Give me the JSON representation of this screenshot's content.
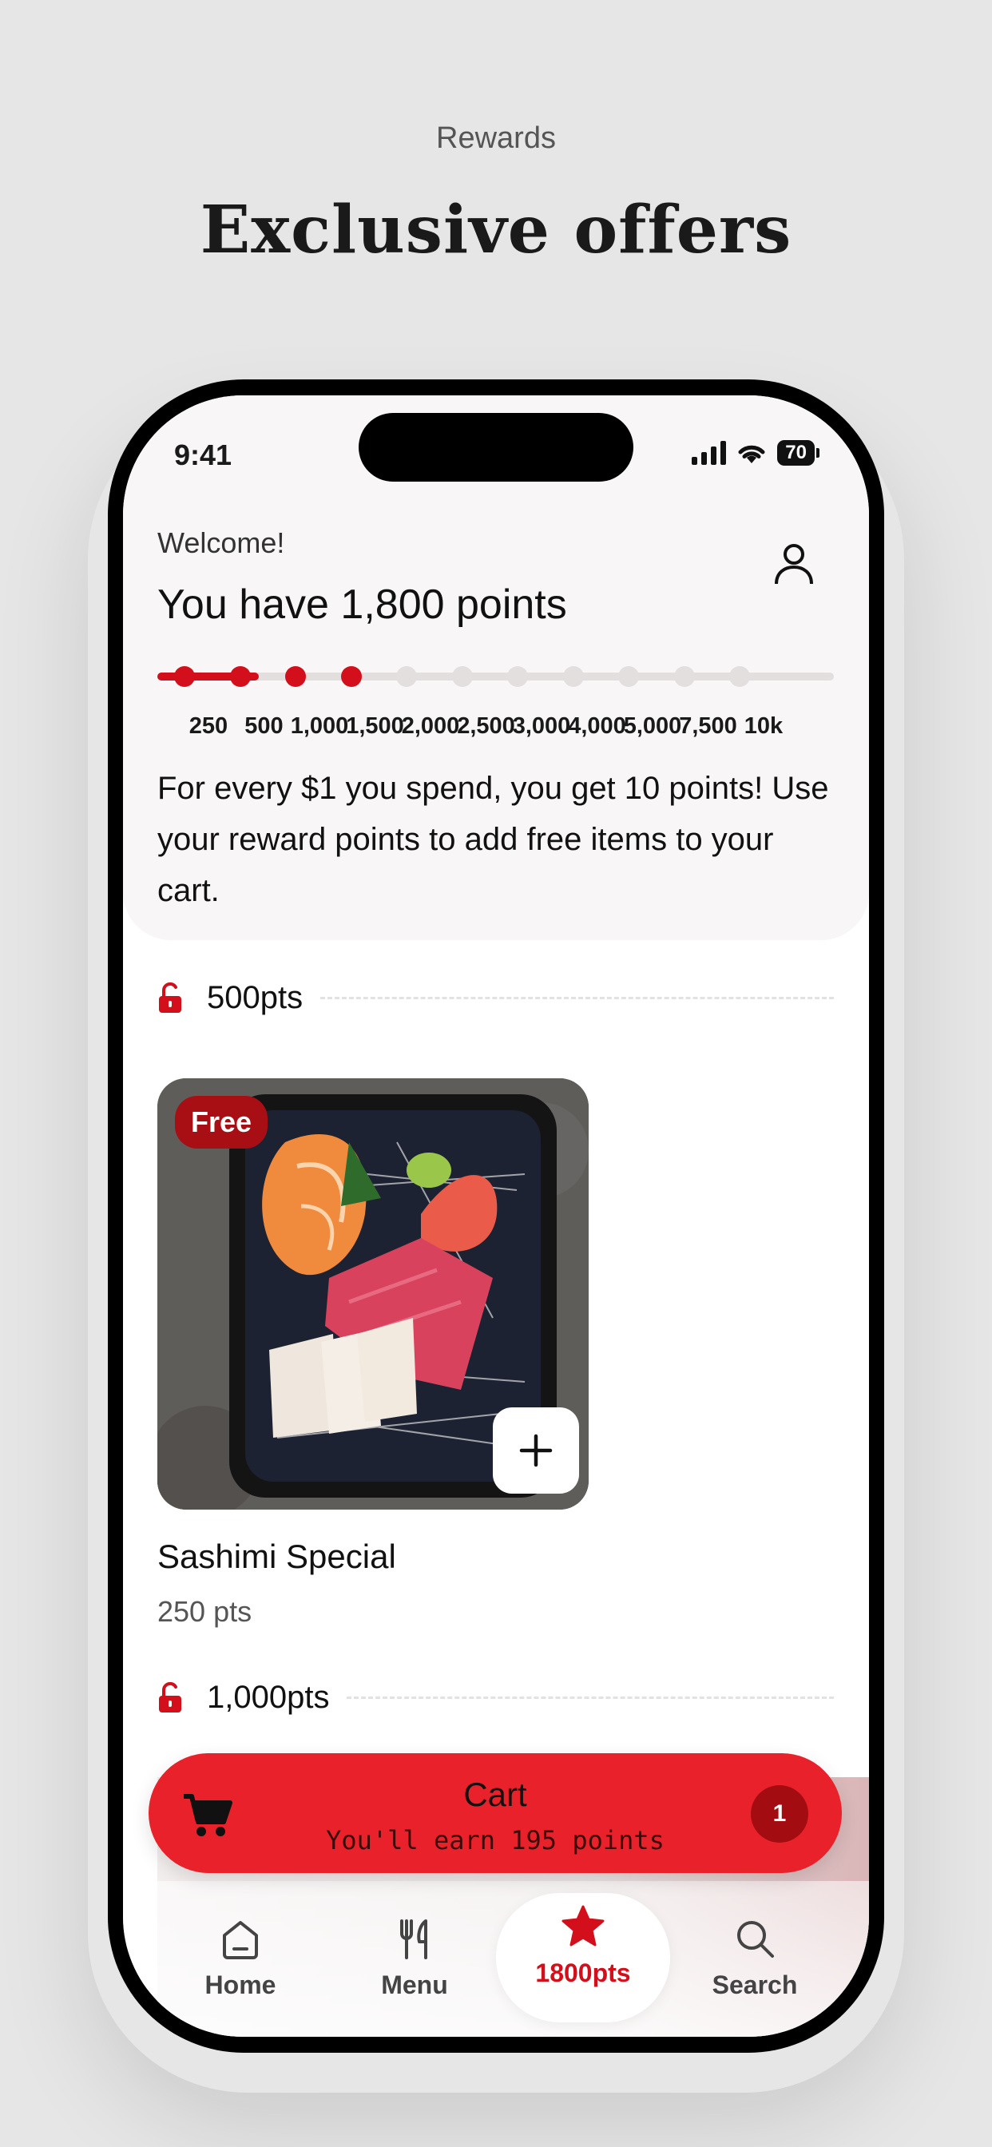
{
  "marketing": {
    "kicker": "Rewards",
    "title": "Exclusive offers"
  },
  "status_bar": {
    "time": "9:41",
    "battery": "70"
  },
  "header": {
    "welcome": "Welcome!",
    "points_heading": "You have 1,800 points",
    "progress_fraction": 0.15,
    "milestones": [
      {
        "label": "250",
        "reached": true
      },
      {
        "label": "500",
        "reached": true
      },
      {
        "label": "1,000",
        "reached": true
      },
      {
        "label": "1,500",
        "reached": true
      },
      {
        "label": "2,000",
        "reached": false
      },
      {
        "label": "2,500",
        "reached": false
      },
      {
        "label": "3,000",
        "reached": false
      },
      {
        "label": "4,000",
        "reached": false
      },
      {
        "label": "5,000",
        "reached": false
      },
      {
        "label": "7,500",
        "reached": false
      },
      {
        "label": "10k",
        "reached": false
      }
    ],
    "info": "For every $1 you spend, you get 10 points! Use your reward points to add free items to your cart."
  },
  "tiers": [
    {
      "label": "500pts"
    },
    {
      "label": "1,000pts"
    }
  ],
  "item": {
    "badge": "Free",
    "name": "Sashimi Special",
    "price": "250 pts"
  },
  "cart": {
    "title": "Cart",
    "subtitle": "You'll earn 195 points",
    "count": "1"
  },
  "nav": [
    {
      "label": "Home",
      "icon": "home-icon"
    },
    {
      "label": "Menu",
      "icon": "fork-knife-icon"
    },
    {
      "label": "1800pts",
      "icon": "star-icon",
      "active": true
    },
    {
      "label": "Search",
      "icon": "search-icon"
    }
  ],
  "colors": {
    "accent": "#d30f1b",
    "cart": "#e8212a",
    "badge": "#a80f14"
  }
}
